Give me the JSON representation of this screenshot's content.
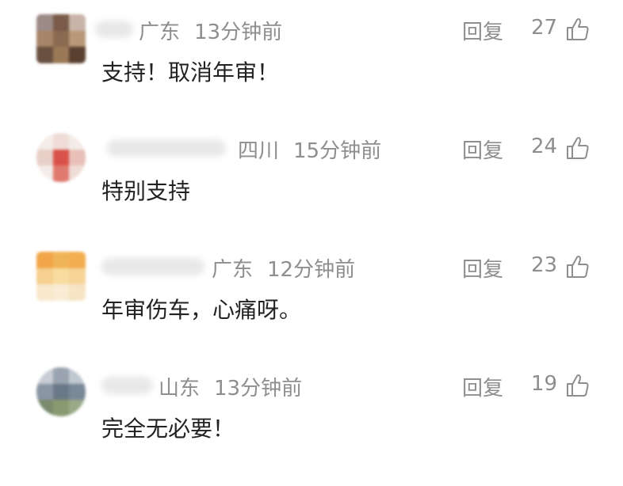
{
  "comments": [
    {
      "location": "广东",
      "time": "13分钟前",
      "reply_label": "回复",
      "likes": "27",
      "text": "支持！取消年审！",
      "avatar_colors": [
        "#9c8a86",
        "#7a5a48",
        "#c8b4a8",
        "#a88468",
        "#8a6a50",
        "#b89878",
        "#6a5040",
        "#9a7858",
        "#5a4030"
      ]
    },
    {
      "location": "四川",
      "time": "15分钟前",
      "reply_label": "回复",
      "likes": "24",
      "text": "特别支持",
      "avatar_colors": [
        "#f4ece8",
        "#f0dcd6",
        "#f4ece8",
        "#e8cfc8",
        "#d9524a",
        "#e8c0b8",
        "#f4ece8",
        "#e07a70",
        "#f0dcd6"
      ]
    },
    {
      "location": "广东",
      "time": "12分钟前",
      "reply_label": "回复",
      "likes": "23",
      "text": "年审伤车，心痛呀。",
      "avatar_colors": [
        "#f2a64a",
        "#f0b458",
        "#f2ae50",
        "#f6d090",
        "#f8dca0",
        "#f6d498",
        "#f8e8cc",
        "#f8ecd4",
        "#f6e4c4"
      ]
    },
    {
      "location": "山东",
      "time": "13分钟前",
      "reply_label": "回复",
      "likes": "19",
      "text": "完全无必要！",
      "avatar_colors": [
        "#c8ccd4",
        "#9aa4b0",
        "#c0c8d0",
        "#8a96a4",
        "#6a7888",
        "#7a8898",
        "#7a8a6c",
        "#8a9a70",
        "#9aaa88"
      ]
    }
  ]
}
